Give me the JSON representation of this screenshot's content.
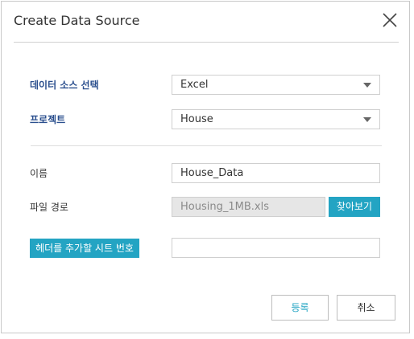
{
  "dialog": {
    "title": "Create Data Source",
    "close_icon": "close-icon"
  },
  "form": {
    "datasource": {
      "label": "데이터 소스 선택",
      "value": "Excel"
    },
    "project": {
      "label": "프로젝트",
      "value": "House"
    },
    "name": {
      "label": "이름",
      "value": "House_Data"
    },
    "filepath": {
      "label": "파일 경로",
      "value": "Housing_1MB.xls",
      "browse_label": "찾아보기"
    },
    "header_sheet": {
      "label": "헤더를 추가할 시트 번호",
      "value": ""
    }
  },
  "footer": {
    "register_label": "등록",
    "cancel_label": "취소"
  },
  "colors": {
    "accent": "#23a4c3",
    "label_bold": "#2b4f8e"
  }
}
